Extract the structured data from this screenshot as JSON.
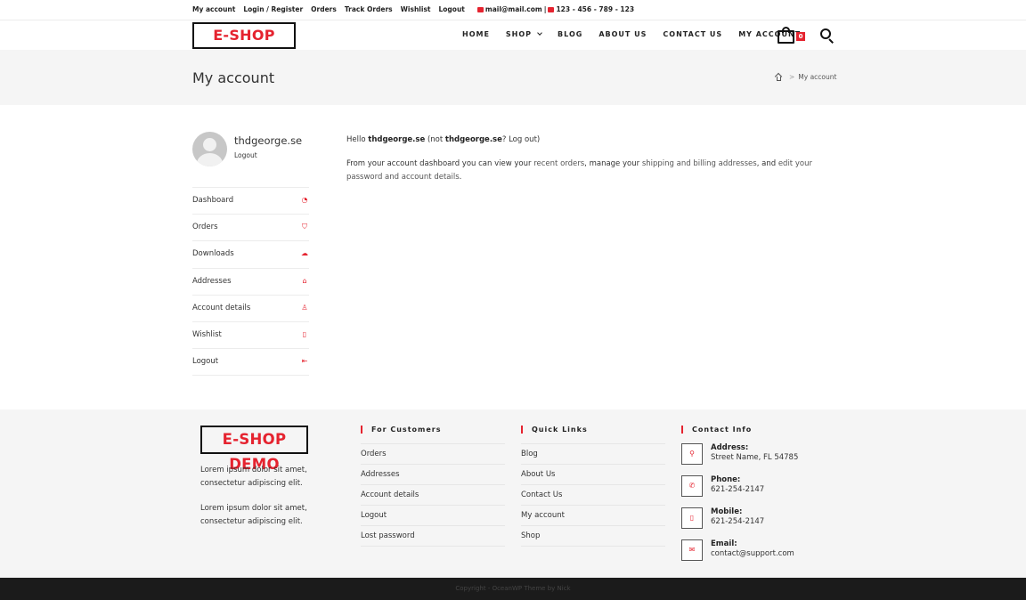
{
  "topbar": {
    "links": [
      "My account",
      "Login / Register",
      "Orders",
      "Track Orders",
      "Wishlist",
      "Logout"
    ],
    "email": "mail@mail.com",
    "separator": "|",
    "phone": "123 - 456 - 789 - 123"
  },
  "header": {
    "logo": "E-SHOP DEMO",
    "nav": [
      "HOME",
      "SHOP",
      "BLOG",
      "ABOUT US",
      "CONTACT US",
      "MY ACCOUNT"
    ],
    "cart_count": "0"
  },
  "page_header": {
    "title": "My account",
    "breadcrumb_sep": ">",
    "breadcrumb_current": "My account"
  },
  "account": {
    "username": "thdgeorge.se",
    "logout_label": "Logout",
    "menu": [
      {
        "label": "Dashboard",
        "icon": "dashboard-icon"
      },
      {
        "label": "Orders",
        "icon": "cart-icon"
      },
      {
        "label": "Downloads",
        "icon": "cloud-download-icon"
      },
      {
        "label": "Addresses",
        "icon": "home-icon"
      },
      {
        "label": "Account details",
        "icon": "user-icon"
      },
      {
        "label": "Wishlist",
        "icon": "list-icon"
      },
      {
        "label": "Logout",
        "icon": "logout-icon"
      }
    ],
    "greeting": {
      "hello": "Hello",
      "name": "thdgeorge.se",
      "not": "(not",
      "name2": "thdgeorge.se",
      "q": "?",
      "logout": "Log out",
      "close": ")"
    },
    "dashboard_text": {
      "p1": "From your account dashboard you can view your",
      "link1": "recent orders",
      "p2": ", manage your",
      "link2": "shipping and billing addresses",
      "p3": ", and",
      "link3": "edit your password and account details",
      "p4": "."
    }
  },
  "footer": {
    "logo": "E-SHOP DEMO",
    "text1": "Lorem ipsum dolor sit amet, consectetur adipiscing elit.",
    "text2": "Lorem ipsum dolor sit amet, consectetur adipiscing elit.",
    "customers_title": "For Customers",
    "customers": [
      "Orders",
      "Addresses",
      "Account details",
      "Logout",
      "Lost password"
    ],
    "quick_title": "Quick Links",
    "quick": [
      "Blog",
      "About Us",
      "Contact Us",
      "My account",
      "Shop"
    ],
    "contact_title": "Contact Info",
    "contact": [
      {
        "label": "Address:",
        "value": "Street Name, FL 54785",
        "icon": "map-pin-icon"
      },
      {
        "label": "Phone:",
        "value": "621-254-2147",
        "icon": "phone-icon"
      },
      {
        "label": "Mobile:",
        "value": "621-254-2147",
        "icon": "mobile-icon"
      },
      {
        "label": "Email:",
        "value": "contact@support.com",
        "icon": "envelope-icon"
      }
    ],
    "copyright": "Copyright - OceanWP Theme by Nick"
  },
  "colors": {
    "accent": "#e5232f",
    "footer_bg": "#f5f5f5",
    "bottom_bar": "#1b1b1b"
  }
}
